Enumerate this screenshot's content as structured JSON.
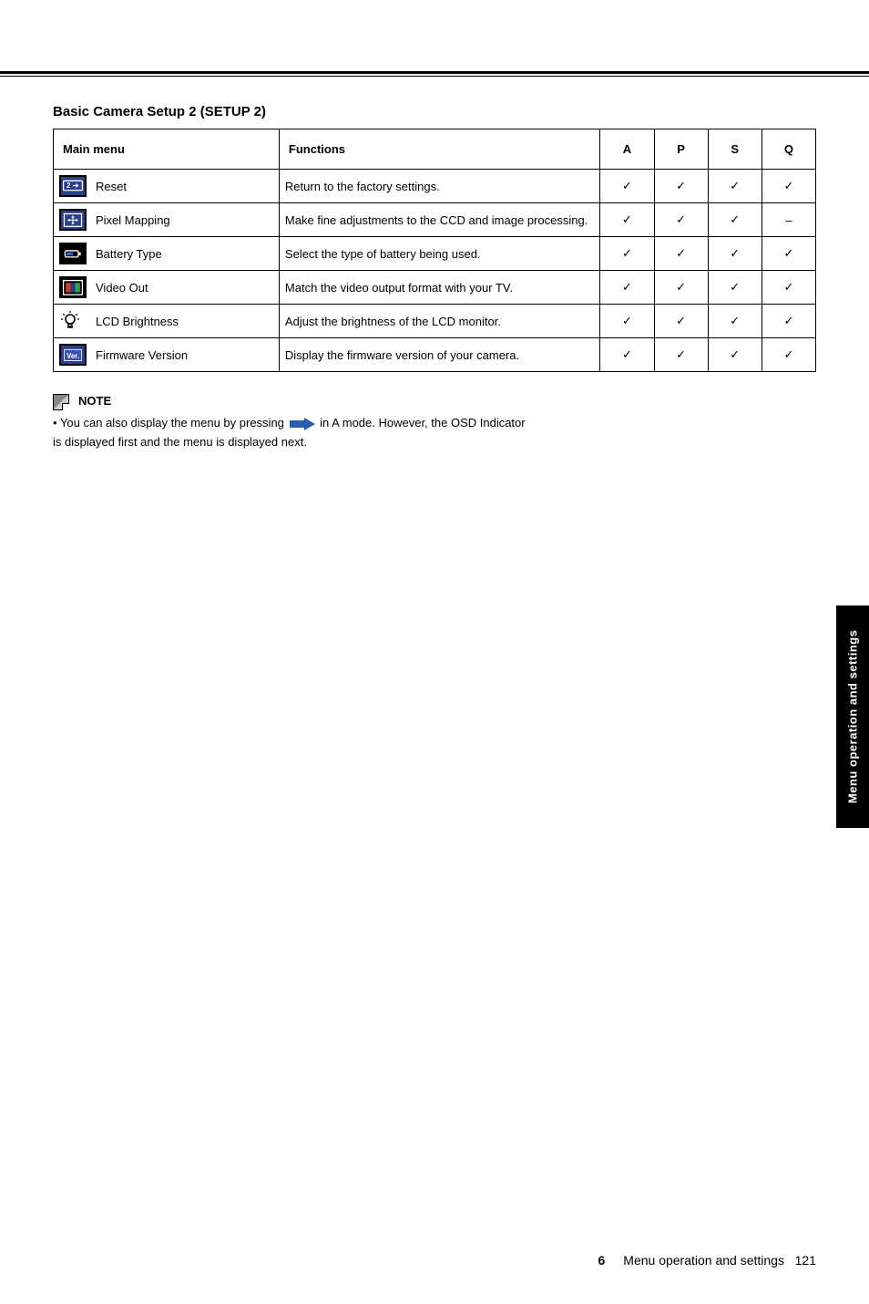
{
  "section_title": "Basic Camera Setup 2 (SETUP 2)",
  "table": {
    "headers": {
      "main_menu": "Main menu",
      "functions": "Functions",
      "modes": [
        "A",
        "P",
        "S",
        "Q"
      ]
    },
    "rows": [
      {
        "label": "Reset",
        "func": "Return to the factory settings.",
        "modes": [
          "✓",
          "✓",
          "✓",
          "✓"
        ]
      },
      {
        "label": "Pixel Mapping",
        "func": "Make fine adjustments to the CCD and image processing.",
        "modes": [
          "✓",
          "✓",
          "✓",
          "–"
        ]
      },
      {
        "label": "Battery Type",
        "func": "Select the type of battery being used.",
        "modes": [
          "✓",
          "✓",
          "✓",
          "✓"
        ]
      },
      {
        "label": "Video Out",
        "func": "Match the video output format with your TV.",
        "modes": [
          "✓",
          "✓",
          "✓",
          "✓"
        ]
      },
      {
        "label": "LCD Brightness",
        "func": "Adjust the brightness of the LCD monitor.",
        "modes": [
          "✓",
          "✓",
          "✓",
          "✓"
        ]
      },
      {
        "label": "Firmware Version",
        "func": "Display the firmware version of your camera.",
        "modes": [
          "✓",
          "✓",
          "✓",
          "✓"
        ]
      }
    ]
  },
  "note": {
    "label": "NOTE",
    "bullet_prefix": "•",
    "line1a": "You can also display the menu by pressing ",
    "line1b": " in A mode. However, the OSD Indicator",
    "line2": "is displayed first and the menu is displayed next."
  },
  "side_tab": "Menu operation and settings",
  "footer": {
    "section": "6",
    "text": "Menu operation and settings",
    "page": "121"
  }
}
